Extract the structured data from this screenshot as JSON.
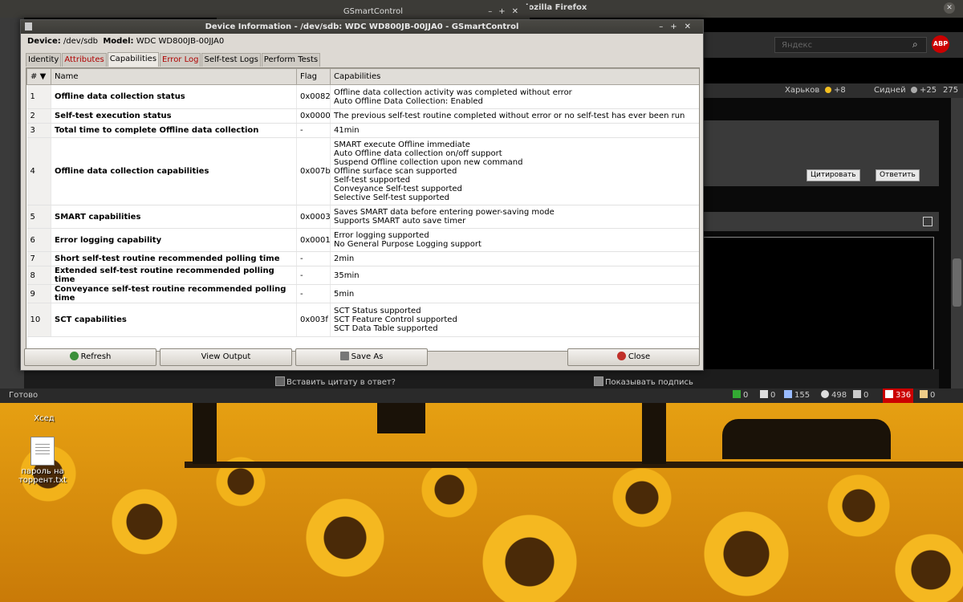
{
  "firefox": {
    "title_fragment": "lozilla Firefox",
    "search_placeholder": "Яндекс",
    "abp_label": "ABP",
    "weather": {
      "city1": "Харьков",
      "temp1": "+8",
      "city2": "Сидней",
      "temp2": "+25",
      "signal": "275"
    },
    "buttons": {
      "quote": "Цитировать",
      "reply": "Ответить"
    },
    "insert_quote_label": "Вставить цитату в ответ?",
    "show_signature_label": "Показывать подпись",
    "status": {
      "ready": "Готово",
      "c1": "0",
      "c2": "0",
      "c3": "155",
      "c4": "498",
      "c5": "0",
      "c6": "336",
      "c7": "0"
    }
  },
  "desktop": {
    "icon1_label": "Хсед",
    "icon2_label": "пароль на торрент.txt"
  },
  "gsc_main_title": "GSmartControl",
  "dialog": {
    "title": "Device Information - /dev/sdb: WDC WD800JB-00JJA0 - GSmartControl",
    "device_label": "Device:",
    "device_value": "/dev/sdb",
    "model_label": "Model:",
    "model_value": "WDC WD800JB-00JJA0",
    "tabs": [
      {
        "label": "Identity"
      },
      {
        "label": "Attributes"
      },
      {
        "label": "Capabilities"
      },
      {
        "label": "Error Log"
      },
      {
        "label": "Self-test Logs"
      },
      {
        "label": "Perform Tests"
      }
    ],
    "columns": {
      "num": "#",
      "name": "Name",
      "flag": "Flag",
      "caps": "Capabilities"
    },
    "rows": [
      {
        "num": "1",
        "name": "Offline data collection status",
        "flag": "0x0082",
        "caps": [
          "Offline data collection activity was completed without error",
          "Auto Offline Data Collection: Enabled"
        ]
      },
      {
        "num": "2",
        "name": "Self-test execution status",
        "flag": "0x0000",
        "caps": [
          "The previous self-test routine completed without error or no self-test has ever been run"
        ]
      },
      {
        "num": "3",
        "name": "Total time to complete Offline data collection",
        "flag": "-",
        "caps": [
          "41min"
        ]
      },
      {
        "num": "4",
        "name": "Offline data collection capabilities",
        "flag": "0x007b",
        "caps": [
          "SMART execute Offline immediate",
          "Auto Offline data collection on/off support",
          "Suspend Offline collection upon new command",
          "Offline surface scan supported",
          "Self-test supported",
          "Conveyance Self-test supported",
          "Selective Self-test supported"
        ]
      },
      {
        "num": "5",
        "name": "SMART capabilities",
        "flag": "0x0003",
        "caps": [
          "Saves SMART data before entering power-saving mode",
          "Supports SMART auto save timer"
        ]
      },
      {
        "num": "6",
        "name": "Error logging capability",
        "flag": "0x0001",
        "caps": [
          "Error logging supported",
          "No General Purpose Logging support"
        ]
      },
      {
        "num": "7",
        "name": "Short self-test routine recommended polling time",
        "flag": "-",
        "caps": [
          "2min"
        ]
      },
      {
        "num": "8",
        "name": "Extended self-test routine recommended polling time",
        "flag": "-",
        "caps": [
          "35min"
        ]
      },
      {
        "num": "9",
        "name": "Conveyance self-test routine recommended polling time",
        "flag": "-",
        "caps": [
          "5min"
        ]
      },
      {
        "num": "10",
        "name": "SCT capabilities",
        "flag": "0x003f",
        "caps": [
          "SCT Status supported",
          "SCT Feature Control supported",
          "SCT Data Table supported"
        ]
      }
    ],
    "buttons": {
      "refresh": "Refresh",
      "view_output": "View Output",
      "save_as": "Save As",
      "close": "Close"
    }
  }
}
